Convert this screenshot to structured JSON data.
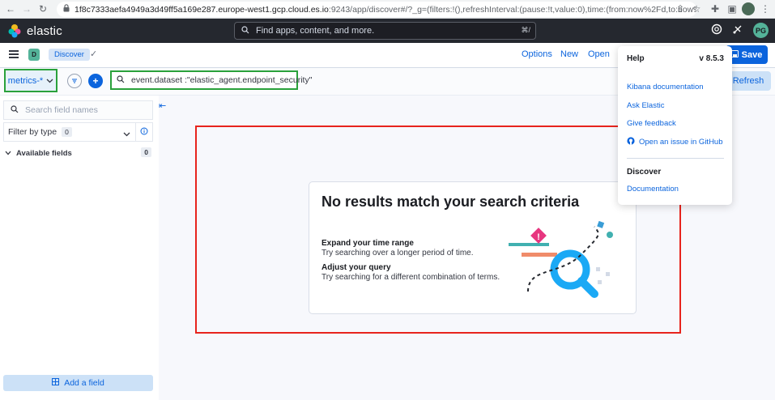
{
  "browser": {
    "url_host": "1f8c7333aefa4949a3d49ff5a169e287.europe-west1.gcp.cloud.es.io",
    "url_path": ":9243/app/discover#/?_g=(filters:!(),refreshInterval:(pause:!t,value:0),time:(from:now%2Fd,to:now%2Fd))&_a=(columns:!(),filte..."
  },
  "header": {
    "logo_text": "elastic",
    "search_placeholder": "Find apps, content, and more.",
    "search_shortcut": "⌘/",
    "avatar_initials": "PG"
  },
  "appbar": {
    "space_initial": "D",
    "breadcrumb": "Discover",
    "options": "Options",
    "new": "New",
    "open": "Open",
    "save": "Save"
  },
  "query": {
    "dataview": "metrics-*",
    "text": "event.dataset :\"elastic_agent.endpoint_security\"",
    "refresh": "Refresh"
  },
  "sidebar": {
    "search_placeholder": "Search field names",
    "filter_label": "Filter by type",
    "filter_count": "0",
    "available_label": "Available fields",
    "available_count": "0",
    "add_field": "Add a field"
  },
  "empty": {
    "title": "No results match your search criteria",
    "s1_title": "Expand your time range",
    "s1_text": "Try searching over a longer period of time.",
    "s2_title": "Adjust your query",
    "s2_text": "Try searching for a different combination of terms."
  },
  "help": {
    "title": "Help",
    "version": "v 8.5.3",
    "links": [
      "Kibana documentation",
      "Ask Elastic",
      "Give feedback",
      "Open an issue in GitHub"
    ],
    "section": "Discover",
    "section_link": "Documentation"
  },
  "colors": {
    "accent": "#0b64dd",
    "header_bg": "#25282f",
    "highlight_green": "#2aa13b",
    "highlight_red": "#e7241d"
  }
}
